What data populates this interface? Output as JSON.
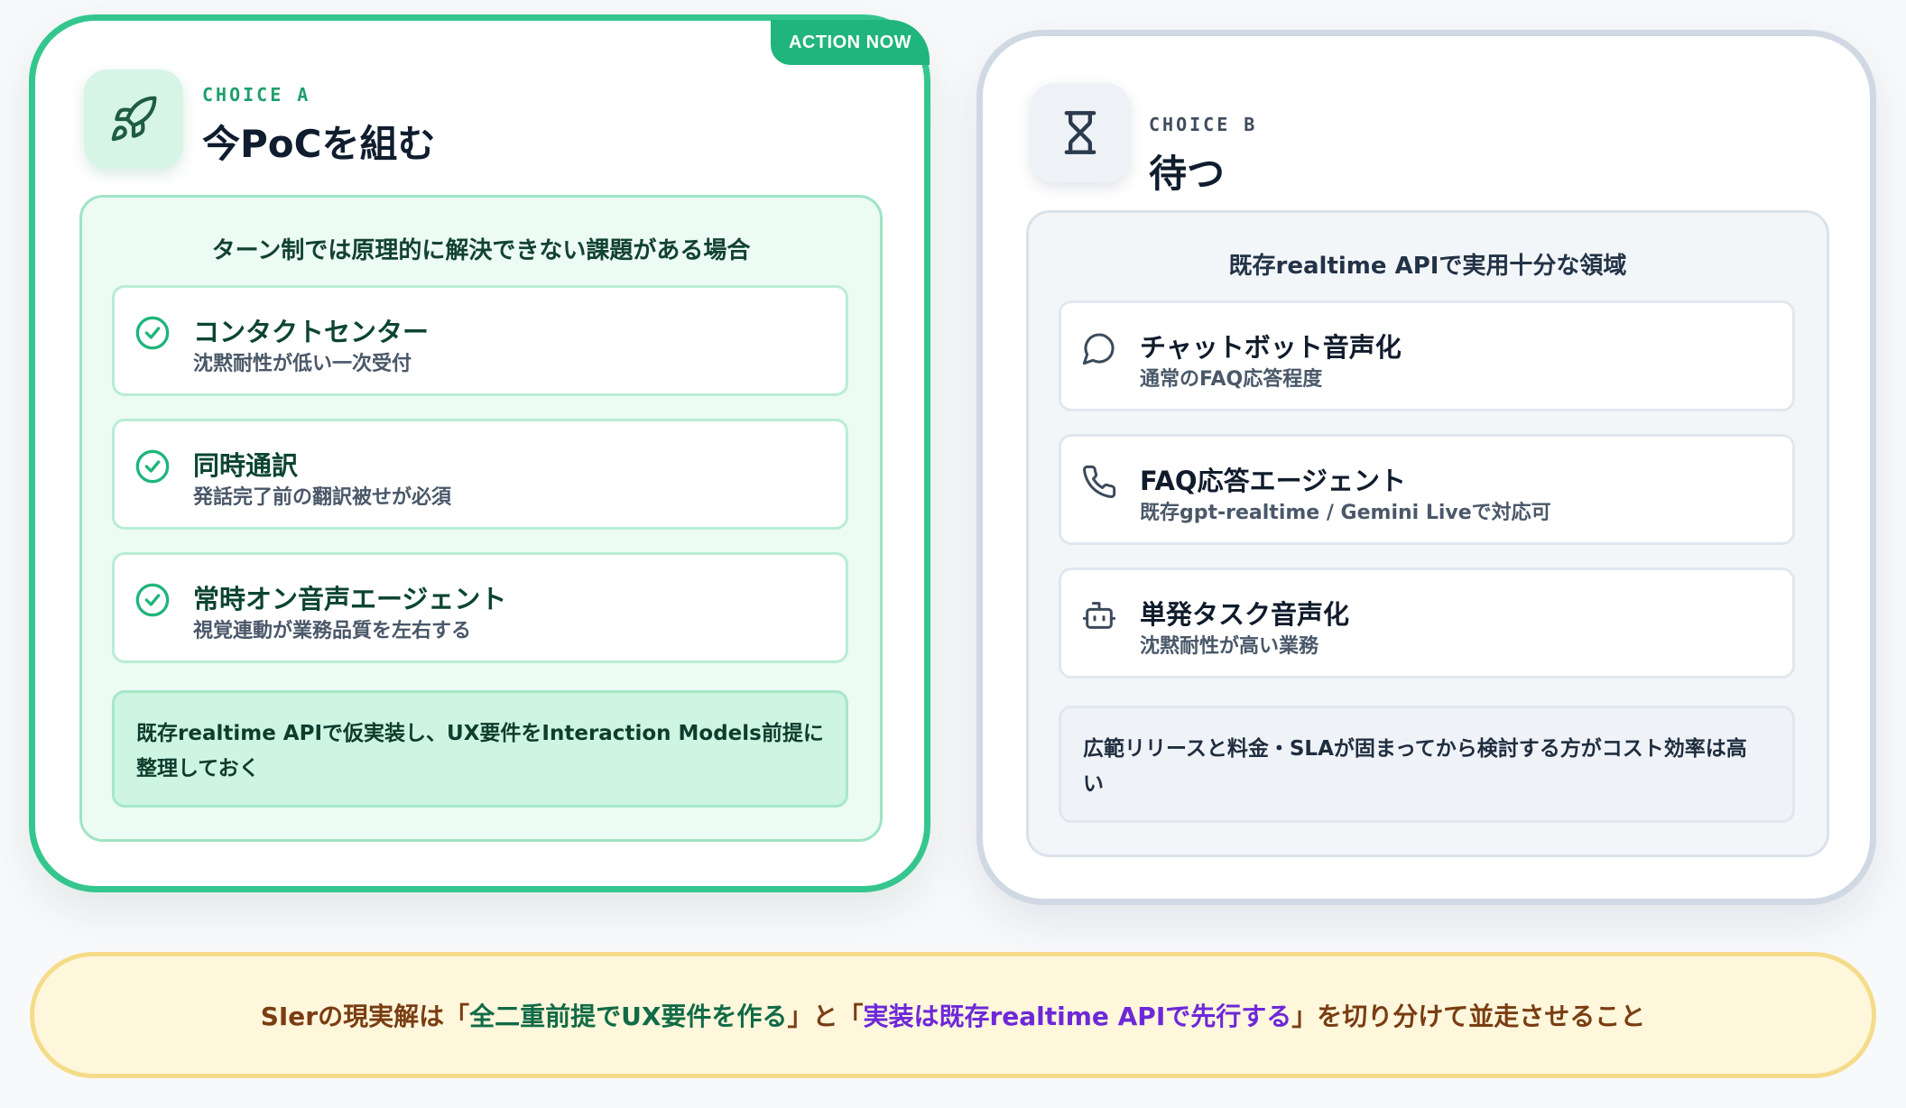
{
  "choice_a": {
    "badge": "ACTION NOW",
    "icon": "rocket-icon",
    "label": "CHOICE A",
    "title": "今PoCを組む",
    "panel_heading": "ターン制では原理的に解決できない課題がある場合",
    "items": [
      {
        "icon": "check-circle-icon",
        "title": "コンタクトセンター",
        "subtitle": "沈黙耐性が低い一次受付"
      },
      {
        "icon": "check-circle-icon",
        "title": "同時通訳",
        "subtitle": "発話完了前の翻訳被せが必須"
      },
      {
        "icon": "check-circle-icon",
        "title": "常時オン音声エージェント",
        "subtitle": "視覚連動が業務品質を左右する"
      }
    ],
    "note_line1": "既存realtime APIで仮実装し、UX要件をInteraction Models前提に",
    "note_line2": "整理しておく"
  },
  "choice_b": {
    "icon": "hourglass-icon",
    "label": "CHOICE B",
    "title": "待つ",
    "panel_heading": "既存realtime APIで実用十分な領域",
    "items": [
      {
        "icon": "chat-bubble-icon",
        "title": "チャットボット音声化",
        "subtitle": "通常のFAQ応答程度"
      },
      {
        "icon": "phone-icon",
        "title": "FAQ応答エージェント",
        "subtitle": "既存gpt-realtime / Gemini Liveで対応可"
      },
      {
        "icon": "bot-icon",
        "title": "単発タスク音声化",
        "subtitle": "沈黙耐性が高い業務"
      }
    ],
    "note_line1": "広範リリースと料金・SLAが固まってから検討する方がコスト効率は高",
    "note_line2": "い"
  },
  "footer": {
    "prefix": "SIerの現実解は「",
    "highlight1": "全二重前提でUX要件を作る",
    "middle": "」と「",
    "highlight2": "実装は既存realtime APIで先行する",
    "suffix": "」を切り分けて並走させること"
  },
  "colors": {
    "accent_green": "#34c68e",
    "badge_green": "#1fb57c",
    "neutral_border": "#d0d9e3",
    "footer_bg": "#fff7dc",
    "footer_border": "#f5dc8a",
    "footer_text": "#7a3d12",
    "highlight_purple": "#6d28d9"
  }
}
